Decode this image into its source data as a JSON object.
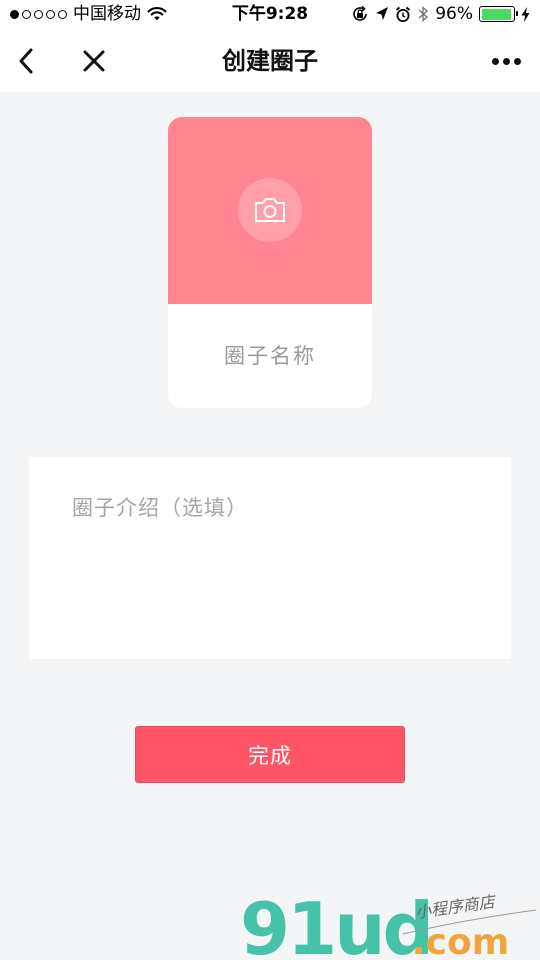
{
  "status_bar": {
    "carrier": "中国移动",
    "time": "下午9:28",
    "battery_percent": "96%",
    "battery_level": 0.96,
    "signal_bars_filled": 1,
    "signal_bars_total": 5,
    "icons": [
      "wifi-icon",
      "rotation-lock-icon",
      "location-icon",
      "alarm-icon",
      "bluetooth-icon",
      "charging-icon"
    ]
  },
  "nav": {
    "title": "创建圈子",
    "back_icon": "chevron-left-icon",
    "close_icon": "close-icon",
    "more_icon": "more-icon"
  },
  "card": {
    "cover_color": "#ff8691",
    "camera_icon": "camera-icon",
    "name_placeholder": "圈子名称"
  },
  "intro": {
    "placeholder": "圈子介绍（选填）"
  },
  "actions": {
    "done_label": "完成",
    "done_color": "#ff5566"
  },
  "watermark": {
    "brand": "91ud",
    "domain": ".com",
    "tagline": "小程序商店"
  }
}
